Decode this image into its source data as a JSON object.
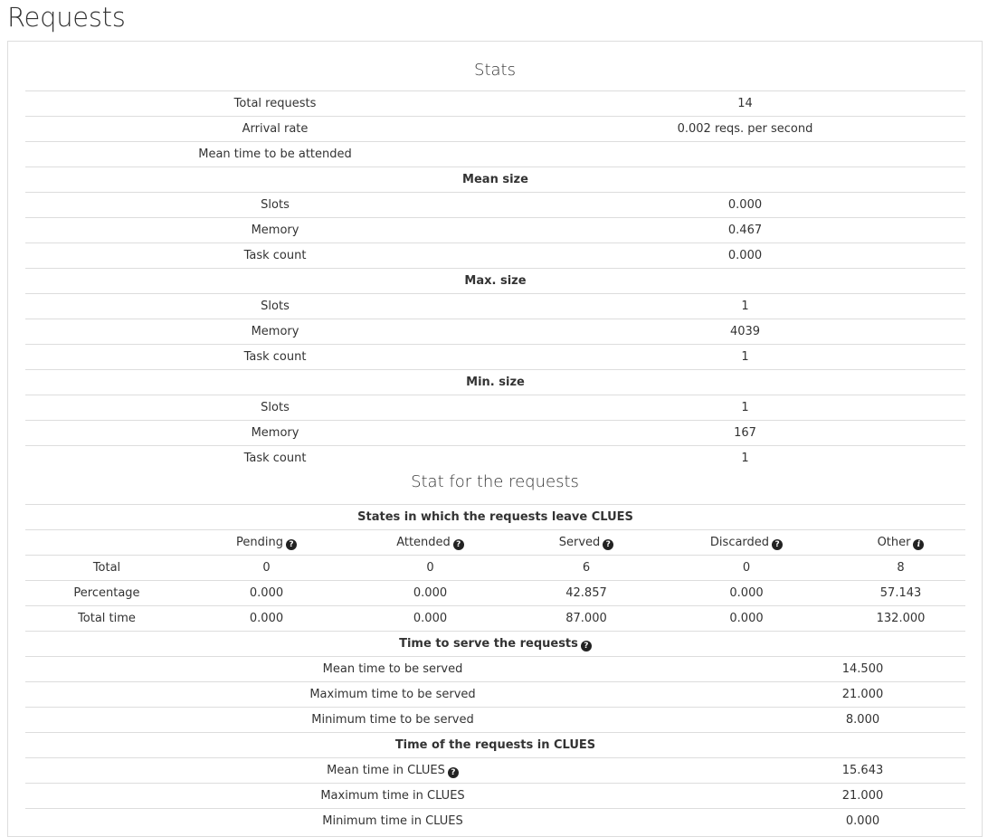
{
  "page_title": "Requests",
  "stats": {
    "title": "Stats",
    "rows": [
      {
        "label": "Total requests",
        "value": "14"
      },
      {
        "label": "Arrival rate",
        "value": "0.002 reqs. per second"
      },
      {
        "label": "Mean time to be attended",
        "value": ""
      }
    ],
    "groups": [
      {
        "title": "Mean size",
        "rows": [
          {
            "label": "Slots",
            "value": "0.000"
          },
          {
            "label": "Memory",
            "value": "0.467"
          },
          {
            "label": "Task count",
            "value": "0.000"
          }
        ]
      },
      {
        "title": "Max. size",
        "rows": [
          {
            "label": "Slots",
            "value": "1"
          },
          {
            "label": "Memory",
            "value": "4039"
          },
          {
            "label": "Task count",
            "value": "1"
          }
        ]
      },
      {
        "title": "Min. size",
        "rows": [
          {
            "label": "Slots",
            "value": "1"
          },
          {
            "label": "Memory",
            "value": "167"
          },
          {
            "label": "Task count",
            "value": "1"
          }
        ]
      }
    ]
  },
  "requests_stats": {
    "title": "Stat for the requests",
    "states": {
      "title": "States in which the requests leave CLUES",
      "columns": [
        "Pending",
        "Attended",
        "Served",
        "Discarded",
        "Other"
      ],
      "column_icons": [
        "help-icon",
        "help-icon",
        "help-icon",
        "help-icon",
        "info-icon"
      ],
      "rows": [
        {
          "label": "Total",
          "values": [
            "0",
            "0",
            "6",
            "0",
            "8"
          ]
        },
        {
          "label": "Percentage",
          "values": [
            "0.000",
            "0.000",
            "42.857",
            "0.000",
            "57.143"
          ]
        },
        {
          "label": "Total time",
          "values": [
            "0.000",
            "0.000",
            "87.000",
            "0.000",
            "132.000"
          ]
        }
      ]
    },
    "serve": {
      "title": "Time to serve the requests",
      "rows": [
        {
          "label": "Mean time to be served",
          "value": "14.500"
        },
        {
          "label": "Maximum time to be served",
          "value": "21.000"
        },
        {
          "label": "Minimum time to be served",
          "value": "8.000"
        }
      ]
    },
    "clues": {
      "title": "Time of the requests in CLUES",
      "rows": [
        {
          "label": "Mean time in CLUES",
          "value": "15.643"
        },
        {
          "label": "Maximum time in CLUES",
          "value": "21.000"
        },
        {
          "label": "Minimum time in CLUES",
          "value": "0.000"
        }
      ]
    }
  }
}
